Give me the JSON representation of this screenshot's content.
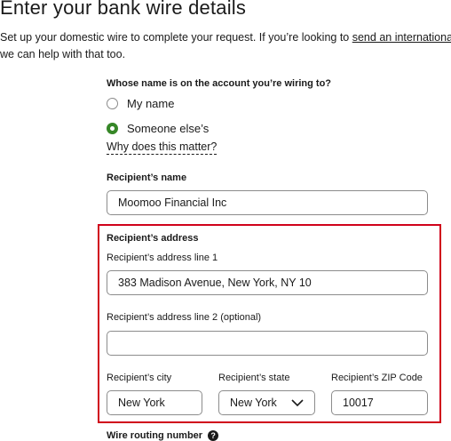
{
  "header": {
    "title": "Enter your bank wire details",
    "intro_before_link": "Set up your domestic wire to complete your request. If you’re looking to ",
    "intro_link": "send an international",
    "intro_after": "we can help with that too."
  },
  "account_owner": {
    "question": "Whose name is on the account you’re wiring to?",
    "options": [
      "My name",
      "Someone else’s"
    ],
    "selected": "Someone else’s",
    "why_link": "Why does this matter?"
  },
  "recipient_name": {
    "label": "Recipient’s name",
    "value": "Moomoo Financial Inc"
  },
  "recipient_address": {
    "section_label": "Recipient’s address",
    "line1_label": "Recipient’s address line 1",
    "line1_value": "383 Madison Avenue, New York, NY 10",
    "line2_label": "Recipient’s address line 2 (optional)",
    "line2_value": "",
    "city_label": "Recipient’s city",
    "city_value": "New York",
    "state_label": "Recipient’s state",
    "state_value": "New York",
    "zip_label": "Recipient’s ZIP Code",
    "zip_value": "10017"
  },
  "routing": {
    "label": "Wire routing number",
    "help_icon": "question-circle-icon"
  },
  "colors": {
    "radio_selected": "#368727",
    "highlight_border": "#d0021b"
  }
}
